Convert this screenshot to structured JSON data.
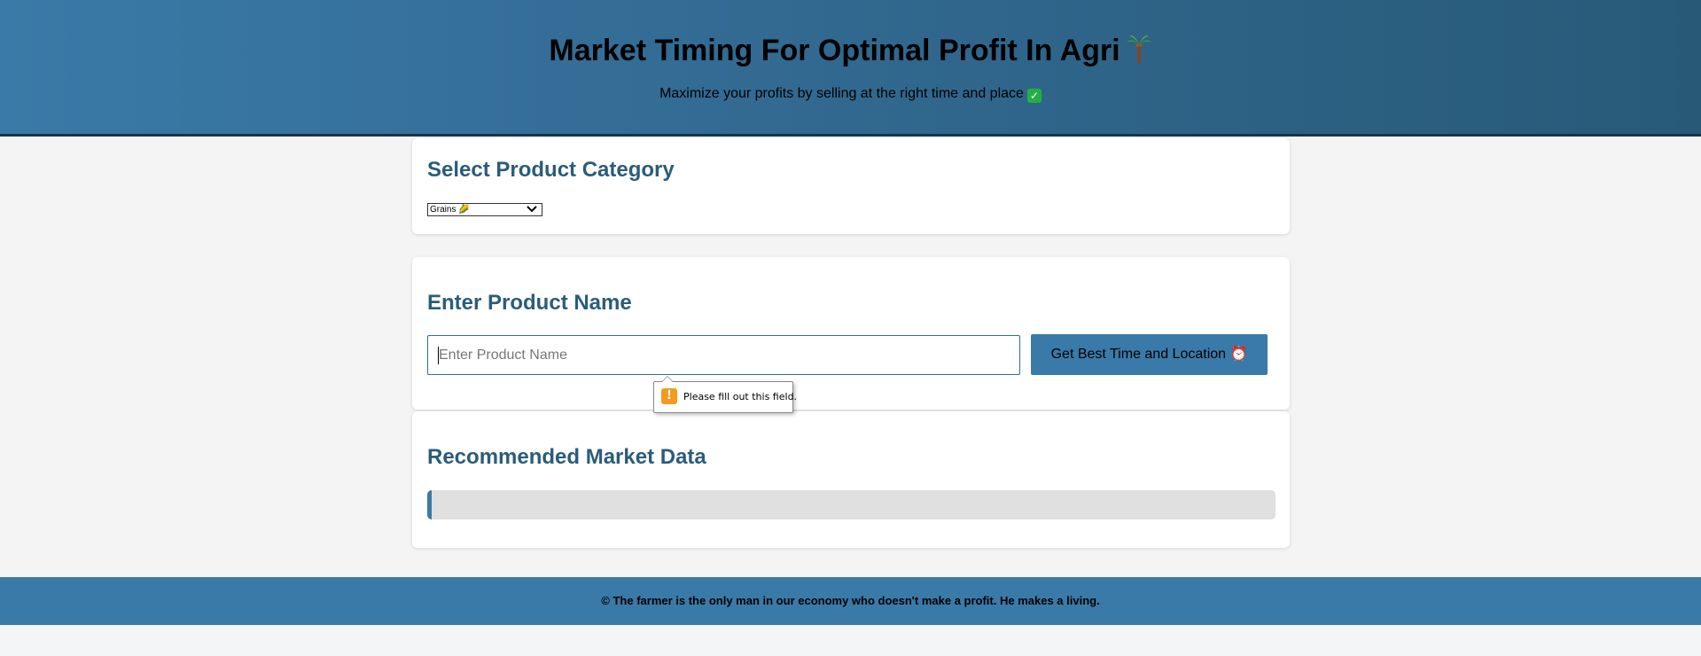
{
  "header": {
    "title": "Market Timing For Optimal Profit In Agri",
    "title_icon": "palm-tree-icon",
    "subtitle": "Maximize your profits by selling at the right time and place",
    "subtitle_icon": "check-mark-icon"
  },
  "category": {
    "heading": "Select Product Category",
    "selected": "Grains 🌽"
  },
  "product": {
    "heading": "Enter Product Name",
    "placeholder": "Enter Product Name",
    "button_label": "Get Best Time and Location ⏰"
  },
  "validation": {
    "message": "Please fill out this field."
  },
  "results": {
    "heading": "Recommended Market Data"
  },
  "footer": {
    "quote": "© The farmer is the only man in our economy who doesn't make a profit. He makes a living."
  },
  "colors": {
    "accent": "#3a7aa8",
    "heading": "#2b5c7a",
    "header_dark": "#285a78"
  }
}
